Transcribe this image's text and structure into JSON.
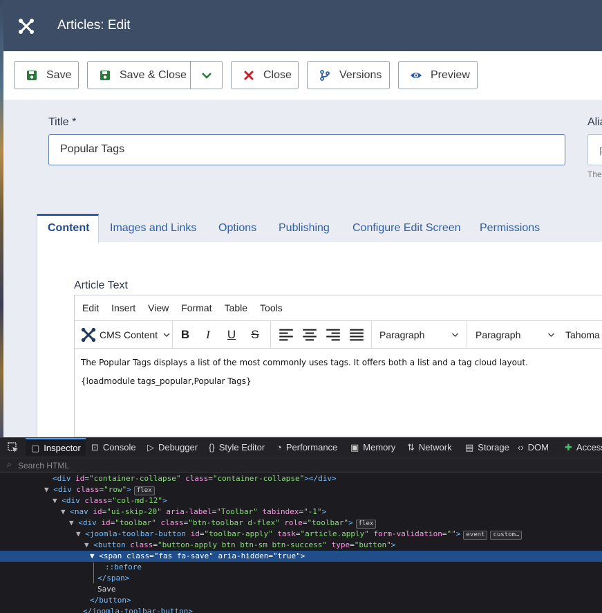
{
  "header": {
    "title": "Articles: Edit"
  },
  "toolbar": {
    "save": "Save",
    "save_close": "Save & Close",
    "close": "Close",
    "versions": "Versions",
    "preview": "Preview"
  },
  "form": {
    "title_label": "Title *",
    "title_value": "Popular Tags",
    "alias_label": "Alia",
    "alias_value": "p",
    "alias_hint": "The"
  },
  "tabs": [
    "Content",
    "Images and Links",
    "Options",
    "Publishing",
    "Configure Edit Screen",
    "Permissions"
  ],
  "editor": {
    "label": "Article Text",
    "menu": [
      "Edit",
      "Insert",
      "View",
      "Format",
      "Table",
      "Tools"
    ],
    "cms_content": "CMS Content",
    "block_format": "Paragraph",
    "block_format2": "Paragraph",
    "font": "Tahoma",
    "paragraph1": "The Popular Tags displays a list of the most commonly uses tags. It offers both a list and a tag cloud layout.",
    "paragraph2": "{loadmodule tags_popular,Popular Tags}"
  },
  "devtools": {
    "tabs": [
      "Inspector",
      "Console",
      "Debugger",
      "Style Editor",
      "Performance",
      "Memory",
      "Network",
      "Storage",
      "DOM",
      "Access"
    ],
    "search_placeholder": "Search HTML",
    "badges": {
      "flex": "flex",
      "event": "event",
      "custom": "custom…"
    },
    "tree": {
      "r0": {
        "tag": "div",
        "attrs": [
          [
            "id",
            "container-collapse"
          ],
          [
            "class",
            "container-collapse"
          ]
        ],
        "close": "</div>"
      },
      "r1": {
        "tag": "div",
        "attrs": [
          [
            "class",
            "row"
          ]
        ]
      },
      "r2": {
        "tag": "div",
        "attrs": [
          [
            "class",
            "col-md-12"
          ]
        ]
      },
      "r3": {
        "tag": "nav",
        "attrs": [
          [
            "id",
            "ui-skip-20"
          ],
          [
            "aria-label",
            "Toolbar"
          ],
          [
            "tabindex",
            "-1"
          ]
        ]
      },
      "r4": {
        "tag": "div",
        "attrs": [
          [
            "id",
            "toolbar"
          ],
          [
            "class",
            "btn-toolbar d-flex"
          ],
          [
            "role",
            "toolbar"
          ]
        ]
      },
      "r5": {
        "tag": "joomla-toolbar-button",
        "attrs": [
          [
            "id",
            "toolbar-apply"
          ],
          [
            "task",
            "article.apply"
          ],
          [
            "form-validation",
            ""
          ]
        ]
      },
      "r6": {
        "tag": "button",
        "attrs": [
          [
            "class",
            "button-apply btn btn-sm btn-success"
          ],
          [
            "type",
            "button"
          ]
        ]
      },
      "r7": {
        "tag": "span",
        "attrs": [
          [
            "class",
            "fas fa-save"
          ],
          [
            "aria-hidden",
            "true"
          ]
        ]
      },
      "r8": "::before",
      "r9": "</span>",
      "r10": "Save",
      "r11": "</button>",
      "r12": "</joomla-toolbar-button>"
    }
  }
}
